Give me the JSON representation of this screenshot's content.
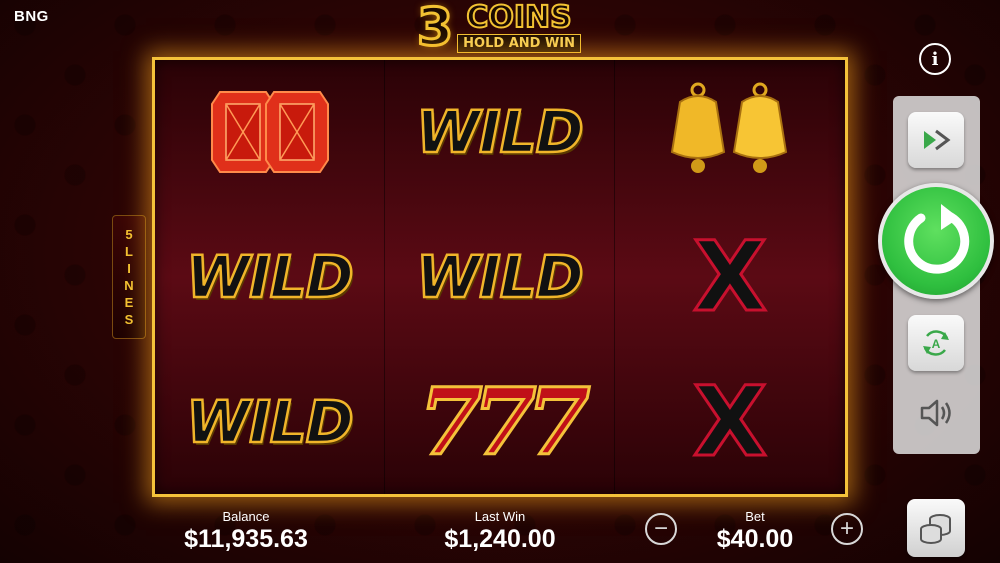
{
  "brand": "BNG",
  "logo": {
    "number": "3",
    "title": "COINS",
    "subtitle": "HOLD AND WIN"
  },
  "lines_badge": [
    "5",
    "L",
    "I",
    "N",
    "E",
    "S"
  ],
  "reels": [
    [
      "gems",
      "WILD",
      "WILD"
    ],
    [
      "WILD",
      "WILD",
      "777"
    ],
    [
      "bells",
      "X",
      "X"
    ]
  ],
  "info_label": "i",
  "footer": {
    "balance_label": "Balance",
    "balance_value": "$11,935.63",
    "last_win_label": "Last Win",
    "last_win_value": "$1,240.00",
    "bet_label": "Bet",
    "bet_value": "$40.00",
    "bet_decrease": "−",
    "bet_increase": "+"
  },
  "colors": {
    "frame_gold": "#f4c23a",
    "spin_green": "#2fbf3f",
    "reel_red": "#5b0a14"
  }
}
